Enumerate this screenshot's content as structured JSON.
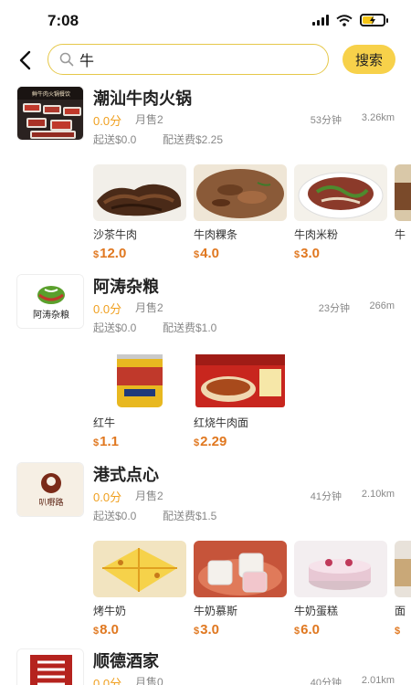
{
  "status": {
    "time": "7:08"
  },
  "search": {
    "query": "牛",
    "button": "搜索"
  },
  "stores": [
    {
      "name": "潮汕牛肉火锅",
      "logo_text": "鲜牛肉火锅餐饮",
      "rating": "0.0分",
      "monthly_sales": "月售2",
      "delivery_time": "53分钟",
      "distance": "3.26km",
      "min_order": "起送$0.0",
      "delivery_fee": "配送费$2.25",
      "products": [
        {
          "name": "沙茶牛肉",
          "currency": "$",
          "price": "12.0"
        },
        {
          "name": "牛肉粿条",
          "currency": "$",
          "price": "4.0"
        },
        {
          "name": "牛肉米粉",
          "currency": "$",
          "price": "3.0"
        },
        {
          "name": "牛",
          "currency": "",
          "price": ""
        }
      ]
    },
    {
      "name": "阿涛杂粮",
      "logo_text": "阿涛杂粮",
      "rating": "0.0分",
      "monthly_sales": "月售2",
      "delivery_time": "23分钟",
      "distance": "266m",
      "min_order": "起送$0.0",
      "delivery_fee": "配送费$1.0",
      "products": [
        {
          "name": "红牛",
          "currency": "$",
          "price": "1.1"
        },
        {
          "name": "红烧牛肉面",
          "currency": "$",
          "price": "2.29"
        }
      ]
    },
    {
      "name": "港式点心",
      "logo_text": "叭嘢路",
      "rating": "0.0分",
      "monthly_sales": "月售2",
      "delivery_time": "41分钟",
      "distance": "2.10km",
      "min_order": "起送$0.0",
      "delivery_fee": "配送费$1.5",
      "products": [
        {
          "name": "烤牛奶",
          "currency": "$",
          "price": "8.0"
        },
        {
          "name": "牛奶慕斯",
          "currency": "$",
          "price": "3.0"
        },
        {
          "name": "牛奶蛋糕",
          "currency": "$",
          "price": "6.0"
        },
        {
          "name": "面",
          "currency": "$",
          "price": ""
        }
      ]
    },
    {
      "name": "顺德酒家",
      "rating": "0.0分",
      "monthly_sales": "月售0",
      "delivery_time": "40分钟",
      "distance": "2.01km"
    }
  ],
  "colors": {
    "accent": "#f7d14a",
    "price": "#e07820",
    "rating": "#f0a020"
  }
}
